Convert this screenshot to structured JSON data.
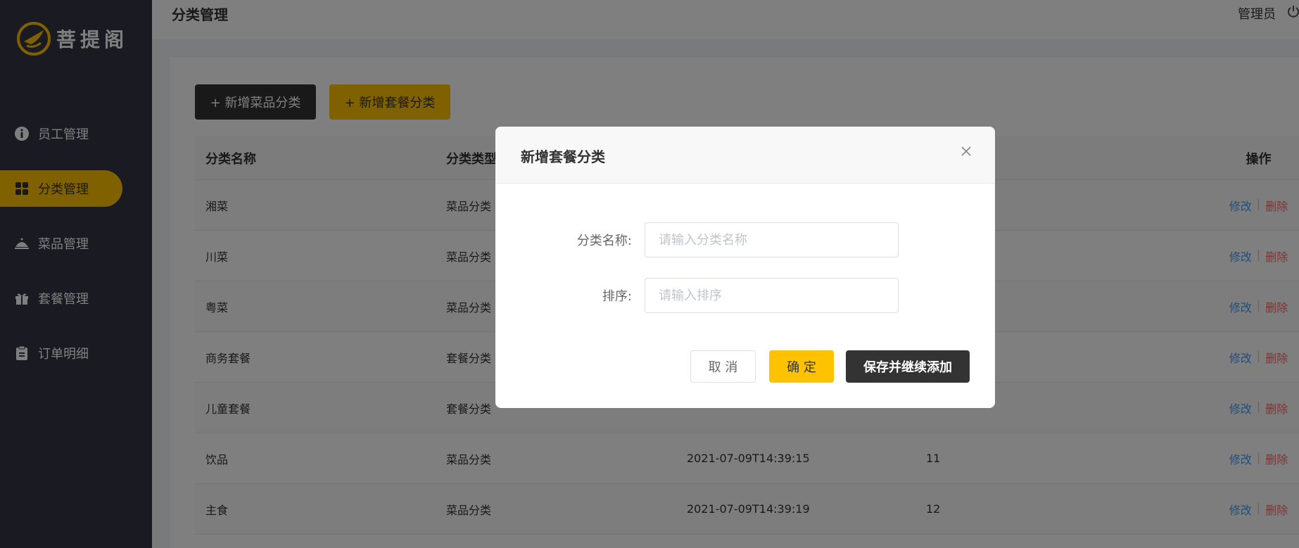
{
  "app": {
    "logo_text": "菩提阁"
  },
  "header": {
    "title": "分类管理",
    "user": "管理员"
  },
  "sidebar": {
    "items": [
      {
        "label": "员工管理",
        "icon": "user-info-icon",
        "active": false
      },
      {
        "label": "分类管理",
        "icon": "grid-icon",
        "active": true
      },
      {
        "label": "菜品管理",
        "icon": "cloche-icon",
        "active": false
      },
      {
        "label": "套餐管理",
        "icon": "gift-icon",
        "active": false
      },
      {
        "label": "订单明细",
        "icon": "clipboard-icon",
        "active": false
      }
    ]
  },
  "toolbar": {
    "add_dish_label": "+ 新增菜品分类",
    "add_combo_label": "+ 新增套餐分类"
  },
  "table": {
    "headers": [
      "分类名称",
      "分类类型",
      "",
      "",
      "操作"
    ],
    "rows": [
      {
        "name": "湘菜",
        "type": "菜品分类",
        "time": "",
        "sort": ""
      },
      {
        "name": "川菜",
        "type": "菜品分类",
        "time": "",
        "sort": ""
      },
      {
        "name": "粤菜",
        "type": "菜品分类",
        "time": "",
        "sort": ""
      },
      {
        "name": "商务套餐",
        "type": "套餐分类",
        "time": "",
        "sort": ""
      },
      {
        "name": "儿童套餐",
        "type": "套餐分类",
        "time": "",
        "sort": ""
      },
      {
        "name": "饮品",
        "type": "菜品分类",
        "time": "2021-07-09T14:39:15",
        "sort": "11"
      },
      {
        "name": "主食",
        "type": "菜品分类",
        "time": "2021-07-09T14:39:19",
        "sort": "12"
      }
    ],
    "edit_label": "修改",
    "delete_label": "删除"
  },
  "dialog": {
    "title": "新增套餐分类",
    "name_label": "分类名称:",
    "name_placeholder": "请输入分类名称",
    "sort_label": "排序:",
    "sort_placeholder": "请输入排序",
    "cancel_label": "取 消",
    "ok_label": "确 定",
    "save_continue_label": "保存并继续添加"
  },
  "colors": {
    "accent": "#ffc200",
    "sidebar": "#343744",
    "dark_button": "#333333",
    "link": "#419efd",
    "danger": "#f56c6c"
  }
}
